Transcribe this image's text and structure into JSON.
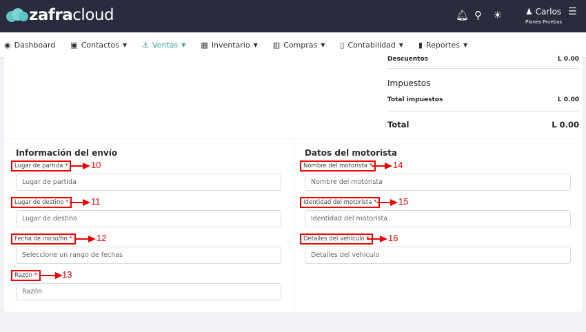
{
  "header": {
    "logo_bold": "zafra",
    "logo_light": "cloud",
    "user": "Carlos",
    "plan": "Planes Pruebas"
  },
  "nav": [
    {
      "label": "Dashboard",
      "icon": "dashboard-icon"
    },
    {
      "label": "Contactos",
      "icon": "contacts-icon"
    },
    {
      "label": "Ventas",
      "icon": "sales-icon"
    },
    {
      "label": "Inventario",
      "icon": "inventory-icon"
    },
    {
      "label": "Compras",
      "icon": "store-icon"
    },
    {
      "label": "Contabilidad",
      "icon": "calculator-icon"
    },
    {
      "label": "Reportes",
      "icon": "chart-icon"
    }
  ],
  "summary": {
    "descuentos": "Descuentos",
    "descuentos_val": "L 0.00",
    "impuestos": "Impuestos",
    "total_impuestos": "Total impuestos",
    "total_impuestos_val": "L 0.00",
    "total": "Total",
    "total_val": "L 0.00"
  },
  "shipping": {
    "title": "Información del envío",
    "fields": [
      {
        "label": "Lugar de partida",
        "placeholder": "Lugar de partida",
        "num": "10"
      },
      {
        "label": "Lugar de destino",
        "placeholder": "Lugar de destino",
        "num": "11"
      },
      {
        "label": "Fecha de inicio/fin",
        "placeholder": "Seleccione un rango de fechas",
        "num": "12"
      },
      {
        "label": "Razón",
        "placeholder": "Razón",
        "num": "13"
      }
    ]
  },
  "driver": {
    "title": "Datos del motorista",
    "fields": [
      {
        "label": "Nombre del motorista",
        "placeholder": "Nombre del motorista",
        "num": "14"
      },
      {
        "label": "Identidad del motorista",
        "placeholder": "Identidad del motorista",
        "num": "15"
      },
      {
        "label": "Detalles del vehículo",
        "placeholder": "Detalles del vehiculo",
        "num": "16"
      }
    ]
  },
  "required_mark": "*"
}
